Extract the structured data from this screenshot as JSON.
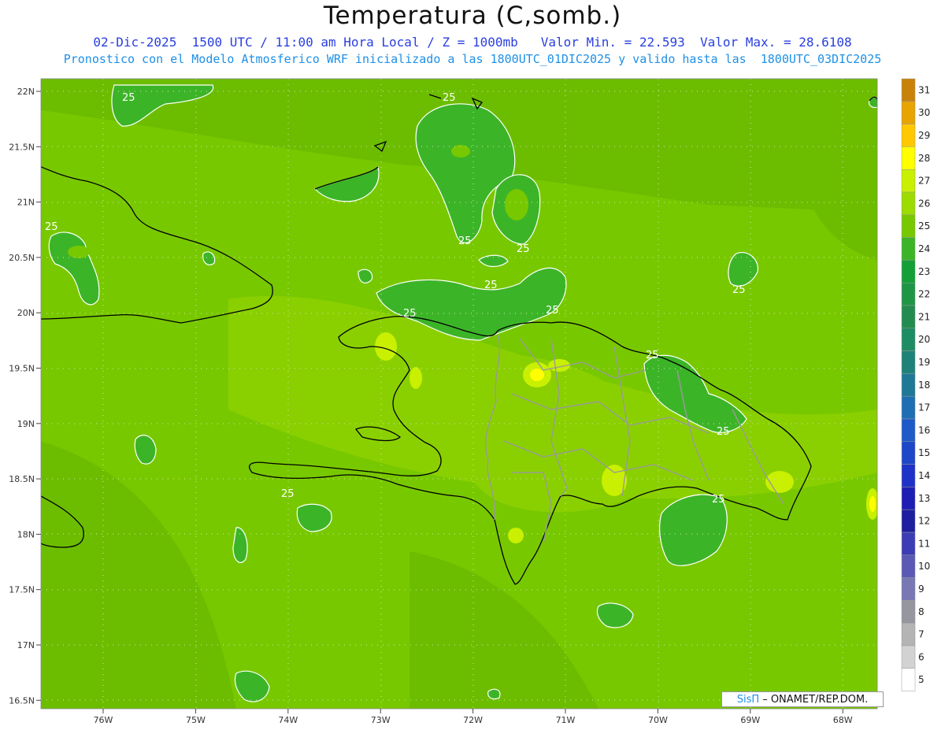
{
  "title": "Temperatura (C,somb.)",
  "subtitle_line1": "02-Dic-2025  1500 UTC / 11:00 am Hora Local / Z = 1000mb   Valor Min. = 22.593  Valor Max. = 28.6108",
  "subtitle_line2": "Pronostico con el Modelo Atmosferico WRF inicializado a las 1800UTC_01DIC2025 y valido hasta las  1800UTC_03DIC2025",
  "credit": {
    "logo": "SisΠ",
    "text": "– ONAMET/REP.DOM."
  },
  "axes": {
    "lat_ticks": [
      "22N",
      "21.5N",
      "21N",
      "20.5N",
      "20N",
      "19.5N",
      "19N",
      "18.5N",
      "18N",
      "17.5N",
      "17N",
      "16.5N"
    ],
    "lon_ticks": [
      "76W",
      "75W",
      "74W",
      "73W",
      "72W",
      "71W",
      "70W",
      "69W",
      "68W"
    ]
  },
  "contour_label": "25",
  "colorbar": {
    "levels": [
      31,
      30,
      29,
      28,
      27,
      26,
      25,
      24,
      23,
      22,
      21,
      20,
      19,
      18,
      17,
      16,
      15,
      14,
      13,
      12,
      11,
      10,
      9,
      8,
      7,
      6,
      5
    ],
    "colors": [
      "#c8820a",
      "#e8a400",
      "#ffc800",
      "#ffff00",
      "#c8f000",
      "#9cdc00",
      "#78c800",
      "#3cb428",
      "#14a037",
      "#1e9646",
      "#228c50",
      "#1e8c64",
      "#1e8278",
      "#1e7896",
      "#1e6eb4",
      "#1e5ac8",
      "#1e46c8",
      "#1e32c8",
      "#1e1eb4",
      "#1e1ea0",
      "#3c3cb4",
      "#5a5ab4",
      "#7878b4",
      "#9696a0",
      "#b4b4b4",
      "#d2d2d2",
      "#ffffff"
    ]
  }
}
